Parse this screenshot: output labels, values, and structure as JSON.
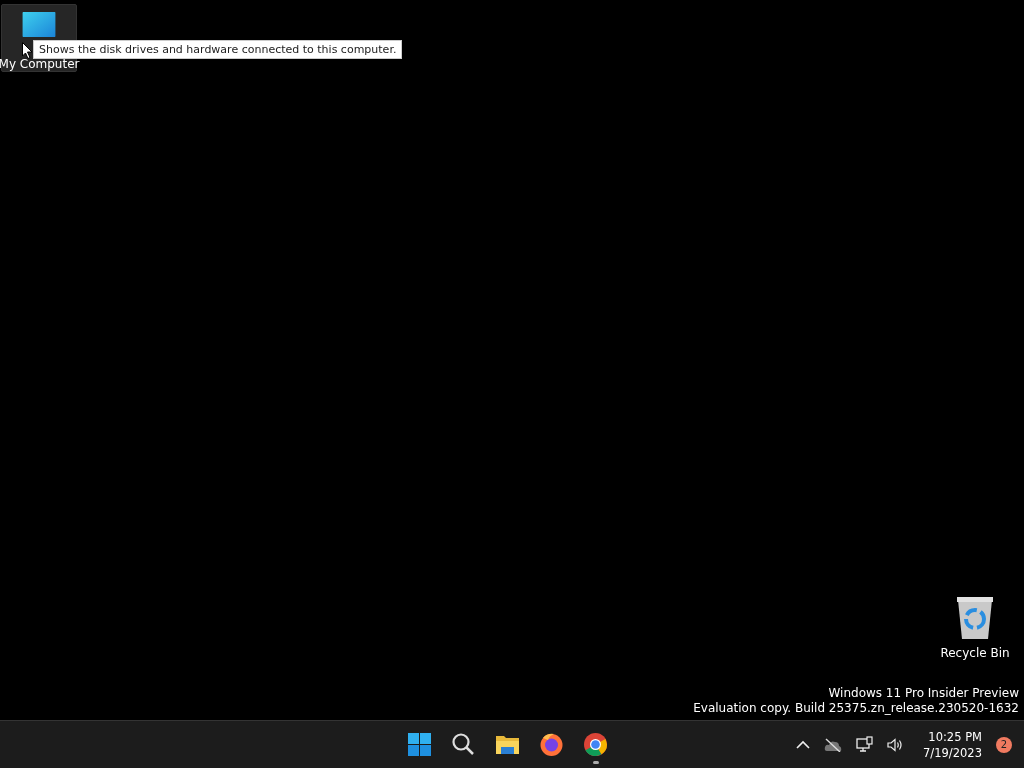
{
  "desktop_icons": [
    {
      "label": "My Computer",
      "kind": "computer",
      "highlighted": true
    },
    {
      "label": "Recycle Bin",
      "kind": "recycle",
      "highlighted": false
    }
  ],
  "tooltip": "Shows the disk drives and hardware connected to this computer.",
  "watermark": [
    "Windows 11 Pro Insider Preview",
    "Evaluation copy. Build 25375.zn_release.230520-1632"
  ],
  "taskbar": {
    "apps": [
      {
        "kind": "start",
        "running": false
      },
      {
        "kind": "search",
        "running": false
      },
      {
        "kind": "explorer",
        "running": false
      },
      {
        "kind": "firefox",
        "running": false
      },
      {
        "kind": "chrome",
        "running": true
      }
    ],
    "time": "10:25 PM",
    "date": "7/19/2023",
    "notification_count": "2"
  }
}
